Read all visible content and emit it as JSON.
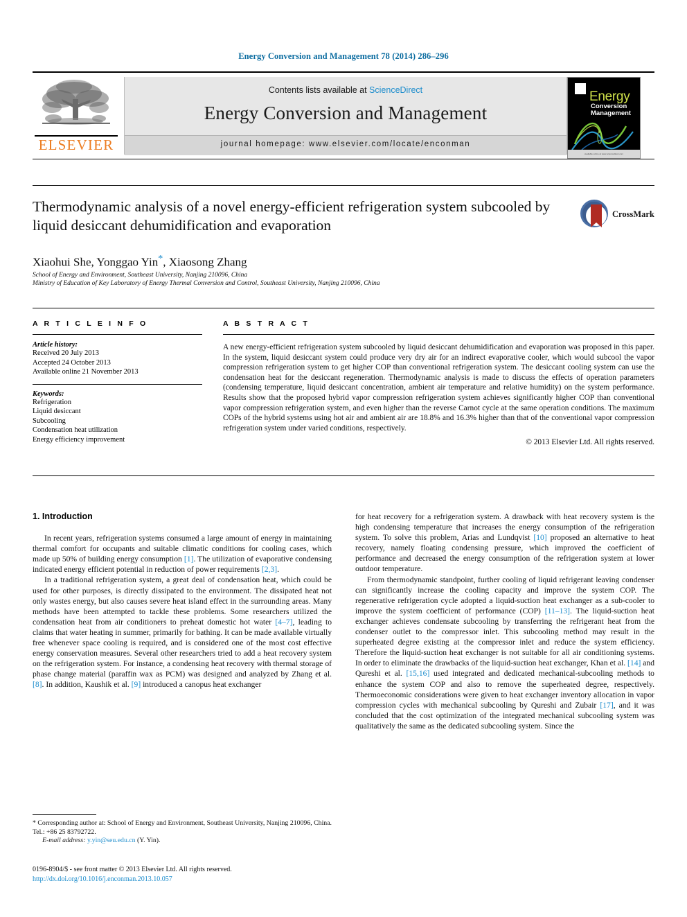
{
  "running_head": "Energy Conversion and Management 78 (2014) 286–296",
  "masthead": {
    "contents_prefix": "Contents lists available at ",
    "sciencedirect": "ScienceDirect",
    "journal_title": "Energy Conversion and Management",
    "homepage": "journal homepage: www.elsevier.com/locate/enconman",
    "publisher": "ELSEVIER",
    "cover": {
      "title": "Energy",
      "subtitle_line1": "Conversion",
      "subtitle_line2": "Management",
      "footer_strip": "available online at www.sciencedirect.com"
    }
  },
  "article": {
    "title": "Thermodynamic analysis of a novel energy-efficient refrigeration system subcooled by liquid desiccant dehumidification and evaporation",
    "crossmark_label": "CrossMark",
    "authors_part1": "Xiaohui She, Yonggao Yin",
    "authors_star": "*",
    "authors_part2": ", Xiaosong Zhang",
    "affiliation_1": "School of Energy and Environment, Southeast University, Nanjing 210096, China",
    "affiliation_2": "Ministry of Education of Key Laboratory of Energy Thermal Conversion and Control, Southeast University, Nanjing 210096, China"
  },
  "article_info": {
    "heading": "A R T I C L E   I N F O",
    "history_label": "Article history:",
    "history": [
      "Received 20 July 2013",
      "Accepted 24 October 2013",
      "Available online 21 November 2013"
    ],
    "keywords_label": "Keywords:",
    "keywords": [
      "Refrigeration",
      "Liquid desiccant",
      "Subcooling",
      "Condensation heat utilization",
      "Energy efficiency improvement"
    ]
  },
  "abstract": {
    "heading": "A B S T R A C T",
    "text": "A new energy-efficient refrigeration system subcooled by liquid desiccant dehumidification and evaporation was proposed in this paper. In the system, liquid desiccant system could produce very dry air for an indirect evaporative cooler, which would subcool the vapor compression refrigeration system to get higher COP than conventional refrigeration system. The desiccant cooling system can use the condensation heat for the desiccant regeneration. Thermodynamic analysis is made to discuss the effects of operation parameters (condensing temperature, liquid desiccant concentration, ambient air temperature and relative humidity) on the system performance. Results show that the proposed hybrid vapor compression refrigeration system achieves significantly higher COP than conventional vapor compression refrigeration system, and even higher than the reverse Carnot cycle at the same operation conditions. The maximum COPs of the hybrid systems using hot air and ambient air are 18.8% and 16.3% higher than that of the conventional vapor compression refrigeration system under varied conditions, respectively.",
    "copyright": "© 2013 Elsevier Ltd. All rights reserved."
  },
  "body": {
    "section_heading": "1. Introduction",
    "left_paragraphs": [
      {
        "segments": [
          {
            "t": "In recent years, refrigeration systems consumed a large amount of energy in maintaining thermal comfort for occupants and suitable climatic conditions for cooling cases, which made up 50% of building energy consumption "
          },
          {
            "t": "[1]",
            "ref": true
          },
          {
            "t": ". The utilization of evaporative condensing indicated energy efficient potential in reduction of power requirements "
          },
          {
            "t": "[2,3]",
            "ref": true
          },
          {
            "t": "."
          }
        ]
      },
      {
        "segments": [
          {
            "t": "In a traditional refrigeration system, a great deal of condensation heat, which could be used for other purposes, is directly dissipated to the environment. The dissipated heat not only wastes energy, but also causes severe heat island effect in the surrounding areas. Many methods have been attempted to tackle these problems. Some researchers utilized the condensation heat from air conditioners to preheat domestic hot water "
          },
          {
            "t": "[4–7]",
            "ref": true
          },
          {
            "t": ", leading to claims that water heating in summer, primarily for bathing. It can be made available virtually free whenever space cooling is required, and is considered one of the most cost effective energy conservation measures. Several other researchers tried to add a heat recovery system on the refrigeration system. For instance, a condensing heat recovery with thermal storage of phase change material (paraffin wax as PCM) was designed and analyzed by Zhang et al. "
          },
          {
            "t": "[8]",
            "ref": true
          },
          {
            "t": ". In addition, Kaushik et al. "
          },
          {
            "t": "[9]",
            "ref": true
          },
          {
            "t": " introduced a canopus heat exchanger"
          }
        ]
      }
    ],
    "right_paragraphs": [
      {
        "segments": [
          {
            "t": "for heat recovery for a refrigeration system. A drawback with heat recovery system is the high condensing temperature that increases the energy consumption of the refrigeration system. To solve this problem, Arias and Lundqvist "
          },
          {
            "t": "[10]",
            "ref": true
          },
          {
            "t": " proposed an alternative to heat recovery, namely floating condensing pressure, which improved the coefficient of performance and decreased the energy consumption of the refrigeration system at lower outdoor temperature."
          }
        ],
        "no_indent": true
      },
      {
        "segments": [
          {
            "t": "From thermodynamic standpoint, further cooling of liquid refrigerant leaving condenser can significantly increase the cooling capacity and improve the system COP. The regenerative refrigeration cycle adopted a liquid-suction heat exchanger as a sub-cooler to improve the system coefficient of performance (COP) "
          },
          {
            "t": "[11–13]",
            "ref": true
          },
          {
            "t": ". The liquid-suction heat exchanger achieves condensate subcooling by transferring the refrigerant heat from the condenser outlet to the compressor inlet. This subcooling method may result in the superheated degree existing at the compressor inlet and reduce the system efficiency. Therefore the liquid-suction heat exchanger is not suitable for all air conditioning systems. In order to eliminate the drawbacks of the liquid-suction heat exchanger, Khan et al. "
          },
          {
            "t": "[14]",
            "ref": true
          },
          {
            "t": " and Qureshi et al. "
          },
          {
            "t": "[15,16]",
            "ref": true
          },
          {
            "t": " used integrated and dedicated mechanical-subcooling methods to enhance the system COP and also to remove the superheated degree, respectively. Thermoeconomic considerations were given to heat exchanger inventory allocation in vapor compression cycles with mechanical subcooling by Qureshi and Zubair "
          },
          {
            "t": "[17]",
            "ref": true
          },
          {
            "t": ", and it was concluded that the cost optimization of the integrated mechanical subcooling system was qualitatively the same as the dedicated subcooling system. Since the"
          }
        ]
      }
    ]
  },
  "footnotes": {
    "corresponding_mark": "*",
    "corresponding_text": " Corresponding author at: School of Energy and Environment, Southeast University, Nanjing 210096, China. Tel.: +86 25 83792722.",
    "email_label": "E-mail address:",
    "email": "y.yin@seu.edu.cn",
    "email_suffix": " (Y. Yin).",
    "issn_line": "0196-8904/$ - see front matter © 2013 Elsevier Ltd. All rights reserved.",
    "doi": "http://dx.doi.org/10.1016/j.enconman.2013.10.057"
  },
  "colors": {
    "link": "#1c8ccc",
    "running_head": "#0b6ca0",
    "elsevier_orange": "#ec7d22",
    "panel_gray": "#e7e7e7"
  }
}
